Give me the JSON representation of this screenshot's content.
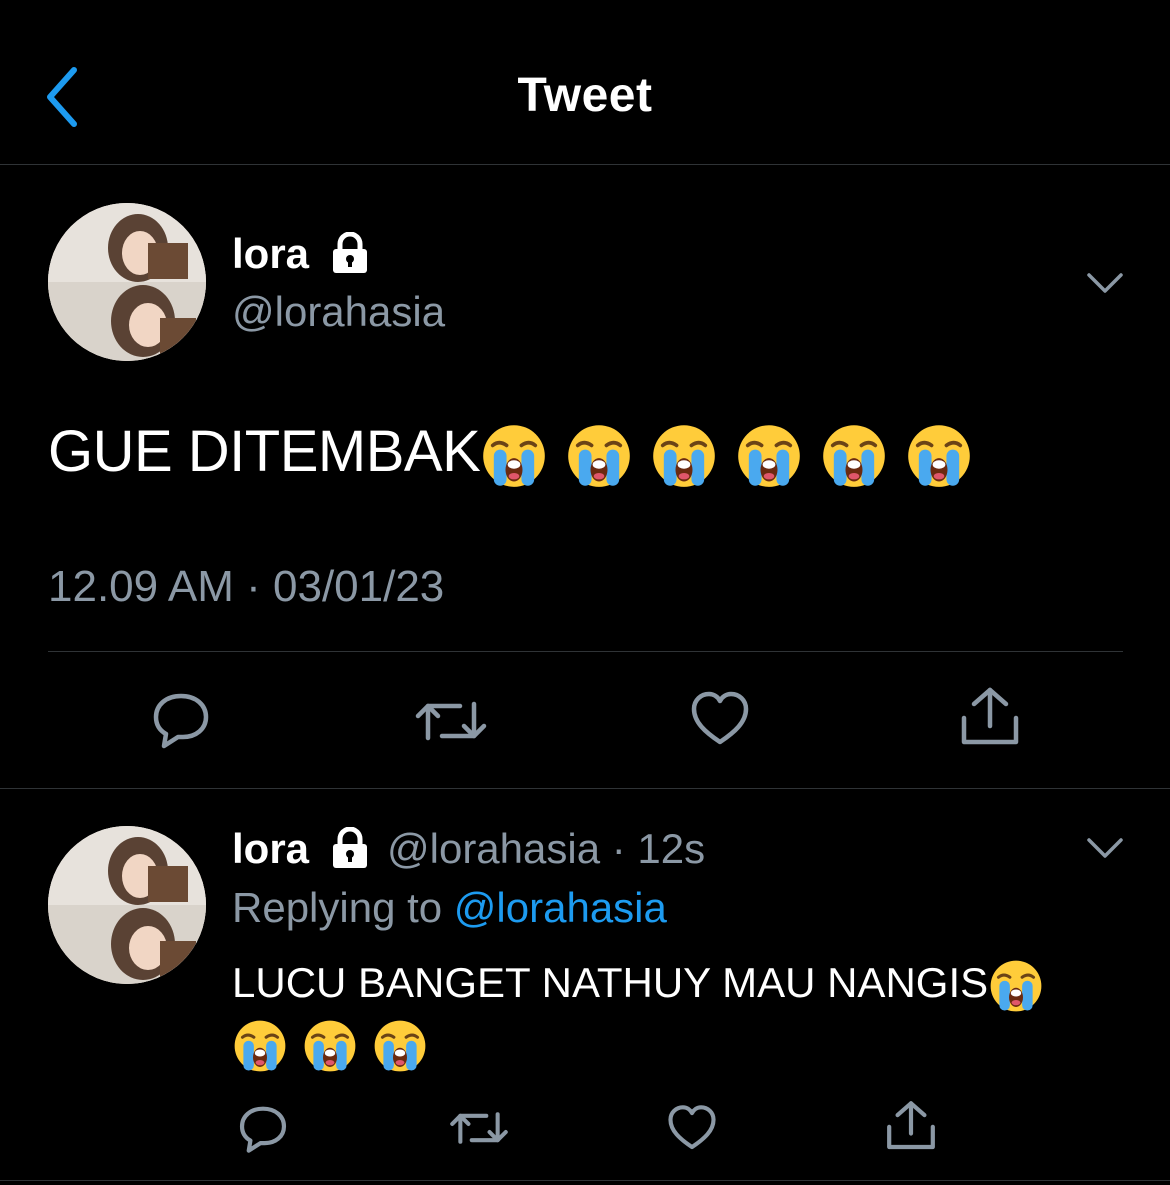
{
  "header": {
    "title": "Tweet",
    "back_icon": "chevron-left-icon"
  },
  "tweet": {
    "display_name": "lora",
    "handle": "@lorahasia",
    "text": "GUE DITEMBAK",
    "emoji_count": 6,
    "timestamp": "12.09 AM · 03/01/23",
    "actions": [
      "reply-icon",
      "retweet-icon",
      "like-icon",
      "share-icon"
    ]
  },
  "reply": {
    "display_name": "lora",
    "handle": "@lorahasia",
    "time": "· 12s",
    "replying_label": "Replying to",
    "replying_to": "@lorahasia",
    "text": "LUCU BANGET NATHUY MAU NANGIS",
    "emoji_count": 4
  },
  "colors": {
    "background": "#000000",
    "text": "#ffffff",
    "secondary": "#8b98a5",
    "accent": "#1d9bf0",
    "divider": "#2f3336"
  }
}
